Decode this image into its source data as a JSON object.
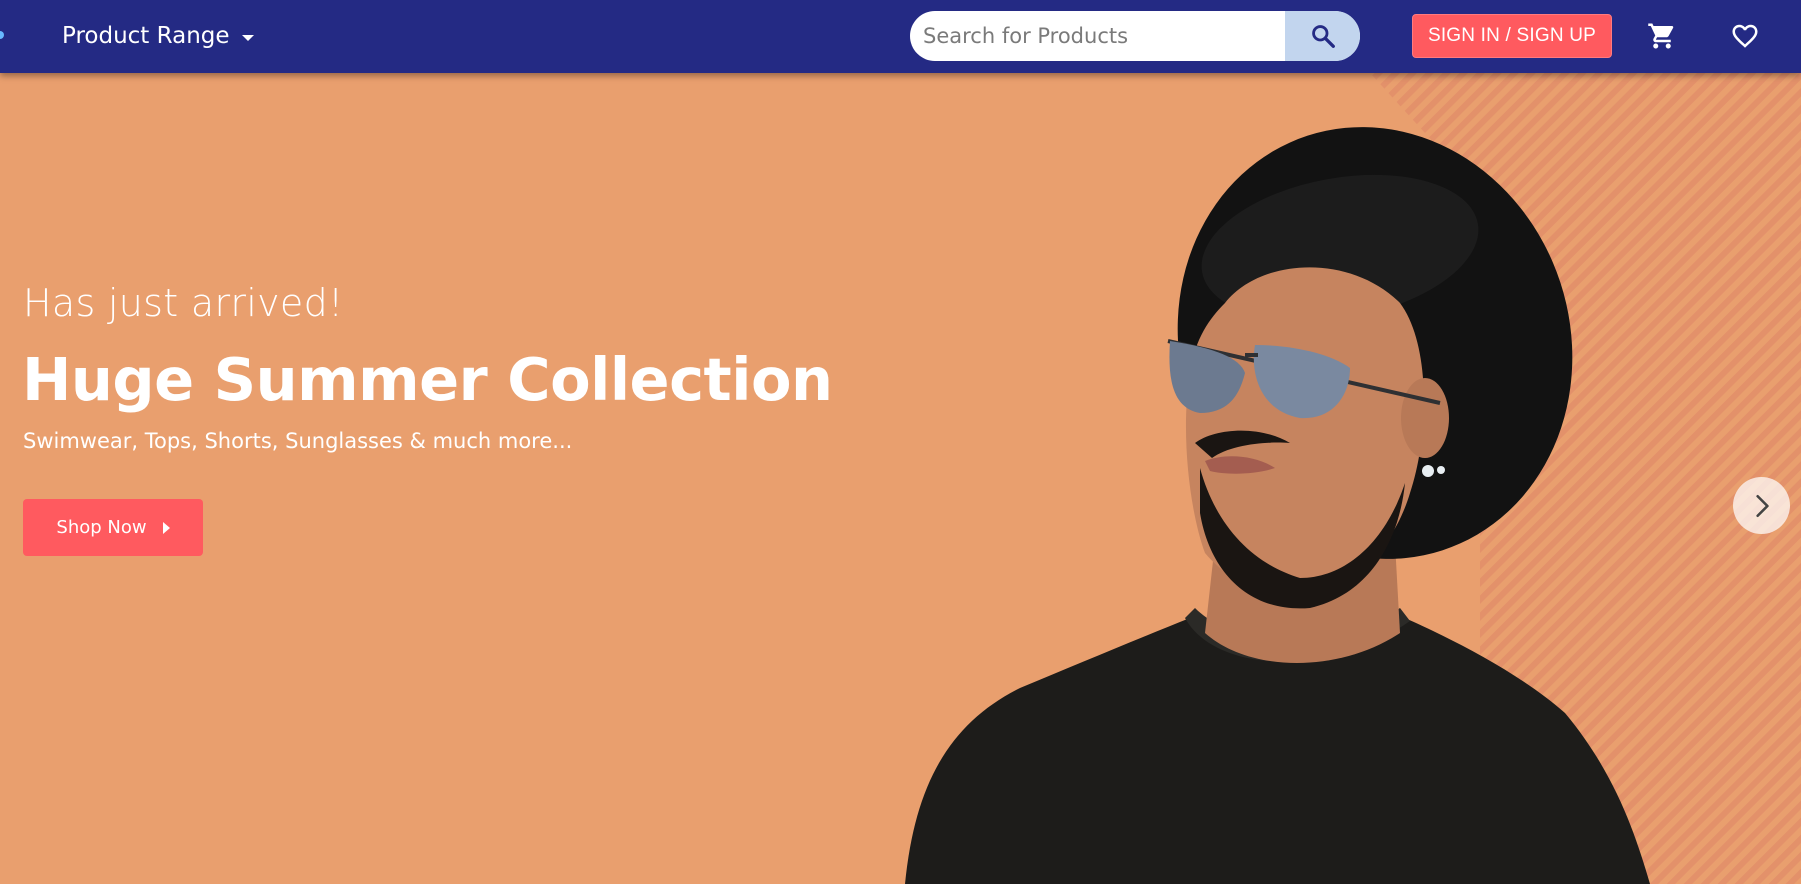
{
  "navbar": {
    "product_range_label": "Product Range",
    "search": {
      "placeholder": "Search for Products",
      "value": ""
    },
    "auth_label": "SIGN IN / SIGN UP",
    "icons": {
      "search": "search-icon",
      "cart": "cart-icon",
      "wishlist": "heart-icon",
      "dropdown": "caret-down-icon"
    }
  },
  "hero": {
    "subtitle": "Has just arrived!",
    "headline": "Huge Summer Collection",
    "description": "Swimwear, Tops, Shorts, Sunglasses & much more...",
    "cta_label": "Shop Now",
    "next_icon": "chevron-right-icon"
  },
  "colors": {
    "navbar": "#242a84",
    "hero_background": "#e99f6e",
    "accent": "#ff5a5f",
    "search_button": "#c2d5ee"
  }
}
